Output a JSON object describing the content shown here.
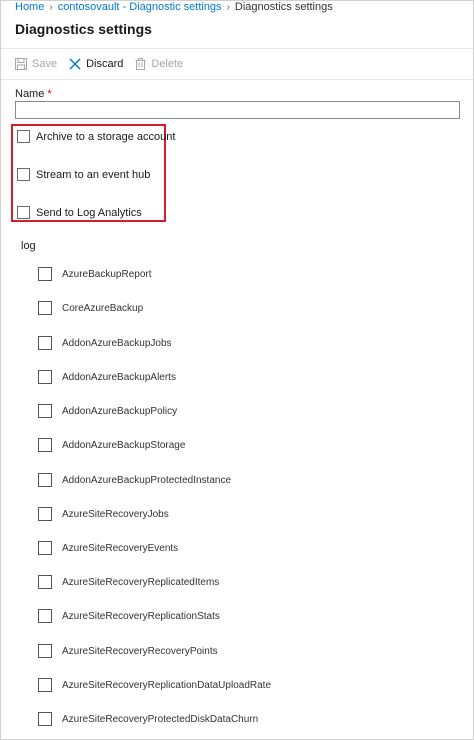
{
  "breadcrumb": {
    "items": [
      "Home",
      "contosovault - Diagnostic settings",
      "Diagnostics settings"
    ]
  },
  "page_title": "Diagnostics settings",
  "toolbar": {
    "save_label": "Save",
    "discard_label": "Discard",
    "delete_label": "Delete"
  },
  "name_field": {
    "label": "Name",
    "required_marker": "*",
    "value": ""
  },
  "destinations": [
    {
      "label": "Archive to a storage account",
      "checked": false
    },
    {
      "label": "Stream to an event hub",
      "checked": false
    },
    {
      "label": "Send to Log Analytics",
      "checked": false
    }
  ],
  "log_section": {
    "header": "log",
    "items": [
      {
        "label": "AzureBackupReport",
        "checked": false
      },
      {
        "label": "CoreAzureBackup",
        "checked": false
      },
      {
        "label": "AddonAzureBackupJobs",
        "checked": false
      },
      {
        "label": "AddonAzureBackupAlerts",
        "checked": false
      },
      {
        "label": "AddonAzureBackupPolicy",
        "checked": false
      },
      {
        "label": "AddonAzureBackupStorage",
        "checked": false
      },
      {
        "label": "AddonAzureBackupProtectedInstance",
        "checked": false
      },
      {
        "label": "AzureSiteRecoveryJobs",
        "checked": false
      },
      {
        "label": "AzureSiteRecoveryEvents",
        "checked": false
      },
      {
        "label": "AzureSiteRecoveryReplicatedItems",
        "checked": false
      },
      {
        "label": "AzureSiteRecoveryReplicationStats",
        "checked": false
      },
      {
        "label": "AzureSiteRecoveryRecoveryPoints",
        "checked": false
      },
      {
        "label": "AzureSiteRecoveryReplicationDataUploadRate",
        "checked": false
      },
      {
        "label": "AzureSiteRecoveryProtectedDiskDataChurn",
        "checked": false
      }
    ]
  },
  "colors": {
    "link": "#0078d4",
    "highlight_border": "#d11f2b",
    "required": "#cc0000",
    "disabled_text": "#a6a6a6"
  },
  "icons": {
    "save": "floppy-disk-icon",
    "discard": "close-x-icon",
    "delete": "trash-icon"
  }
}
